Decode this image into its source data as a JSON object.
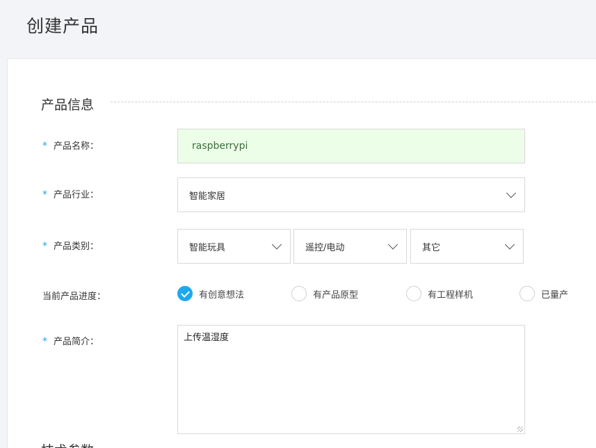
{
  "header": {
    "title": "创建产品"
  },
  "section": {
    "product_info_title": "产品信息",
    "next_title": "技术参数"
  },
  "fields": {
    "name": {
      "label": "产品名称：",
      "required": true,
      "value": "raspberrypi"
    },
    "industry": {
      "label": "产品行业：",
      "required": true,
      "value": "智能家居"
    },
    "category": {
      "label": "产品类别：",
      "required": true,
      "level1": "智能玩具",
      "level2": "遥控/电动",
      "level3": "其它"
    },
    "progress": {
      "label": "当前产品进度：",
      "options": [
        "有创意想法",
        "有产品原型",
        "有工程样机",
        "已量产"
      ],
      "selected": "有创意想法"
    },
    "intro": {
      "label": "产品简介：",
      "required": true,
      "value": "上传温湿度"
    }
  },
  "colors": {
    "accent": "#1ea8ef",
    "required_mark": "#29a0e0",
    "valid_bg": "#ecfde8"
  },
  "icons": {
    "select_arrow": "chevron-down-icon",
    "radio_checked": "check-icon"
  }
}
